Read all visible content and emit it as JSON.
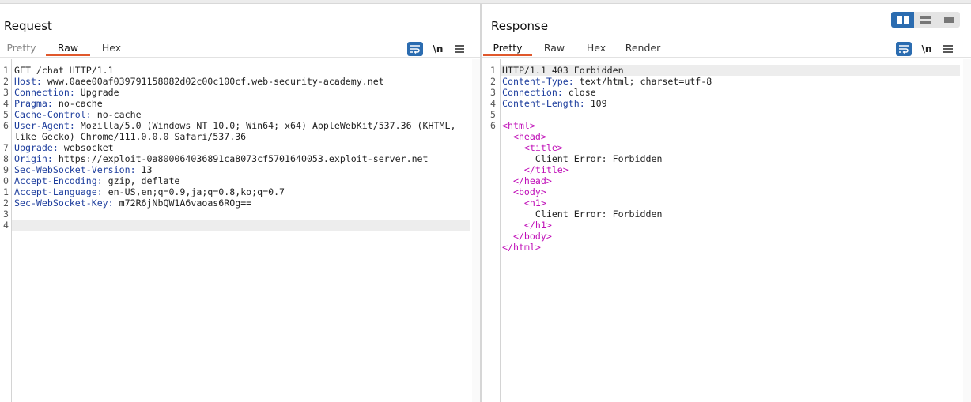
{
  "request": {
    "title": "Request",
    "tabs": [
      "Pretty",
      "Raw",
      "Hex"
    ],
    "active_tab": "Raw",
    "lines": [
      {
        "n": "1",
        "text": "GET /chat HTTP/1.1"
      },
      {
        "n": "2",
        "key": "Host",
        "value": " www.0aee00af039791158082d02c00c100cf.web-security-academy.net"
      },
      {
        "n": "3",
        "key": "Connection",
        "value": " Upgrade"
      },
      {
        "n": "4",
        "key": "Pragma",
        "value": " no-cache"
      },
      {
        "n": "5",
        "key": "Cache-Control",
        "value": " no-cache"
      },
      {
        "n": "6",
        "key": "User-Agent",
        "value": " Mozilla/5.0 (Windows NT 10.0; Win64; x64) AppleWebKit/537.36 (KHTML,"
      },
      {
        "n": "",
        "text": "like Gecko) Chrome/111.0.0.0 Safari/537.36"
      },
      {
        "n": "7",
        "key": "Upgrade",
        "value": " websocket"
      },
      {
        "n": "8",
        "key": "Origin",
        "value": " https://exploit-0a800064036891ca8073cf5701640053.exploit-server.net"
      },
      {
        "n": "9",
        "key": "Sec-WebSocket-Version",
        "value": " 13"
      },
      {
        "n": "0",
        "key": "Accept-Encoding",
        "value": " gzip, deflate"
      },
      {
        "n": "1",
        "key": "Accept-Language",
        "value": " en-US,en;q=0.9,ja;q=0.8,ko;q=0.7"
      },
      {
        "n": "2",
        "key": "Sec-WebSocket-Key",
        "value": " m72R6jNbQW1A6vaoas6ROg=="
      },
      {
        "n": "3",
        "text": ""
      },
      {
        "n": "4",
        "text": ""
      }
    ],
    "highlight_line": 14
  },
  "response": {
    "title": "Response",
    "tabs": [
      "Pretty",
      "Raw",
      "Hex",
      "Render"
    ],
    "active_tab": "Pretty",
    "lines": [
      {
        "n": "1",
        "text": "HTTP/1.1 403 Forbidden"
      },
      {
        "n": "2",
        "key": "Content-Type",
        "value": " text/html; charset=utf-8"
      },
      {
        "n": "3",
        "key": "Connection",
        "value": " close"
      },
      {
        "n": "4",
        "key": "Content-Length",
        "value": " 109"
      },
      {
        "n": "5",
        "text": ""
      },
      {
        "n": "6",
        "tag": "<html>",
        "indent": ""
      },
      {
        "n": "",
        "tag": "<head>",
        "indent": "  "
      },
      {
        "n": "",
        "tag": "<title>",
        "indent": "    "
      },
      {
        "n": "",
        "text": "      Client Error: Forbidden"
      },
      {
        "n": "",
        "tag": "</title>",
        "indent": "    "
      },
      {
        "n": "",
        "tag": "</head>",
        "indent": "  "
      },
      {
        "n": "",
        "tag": "<body>",
        "indent": "  "
      },
      {
        "n": "",
        "tag": "<h1>",
        "indent": "    "
      },
      {
        "n": "",
        "text": "      Client Error: Forbidden"
      },
      {
        "n": "",
        "tag": "</h1>",
        "indent": "    "
      },
      {
        "n": "",
        "tag": "</body>",
        "indent": "  "
      },
      {
        "n": "",
        "tag": "</html>",
        "indent": ""
      }
    ],
    "highlight_line": 0
  },
  "toolbar": {
    "wrap_icon": "word-wrap-icon",
    "newline_label": "\\n",
    "menu_icon": "hamburger-menu-icon"
  },
  "layout_toggle": {
    "icons": [
      "split-horizontal-icon",
      "split-vertical-icon",
      "single-pane-icon"
    ],
    "active_index": 0
  },
  "colors": {
    "accent": "#2b6cb0",
    "active_tab_underline": "#e0582c",
    "header_key": "#1f3f9e",
    "tag": "#c010b8"
  }
}
